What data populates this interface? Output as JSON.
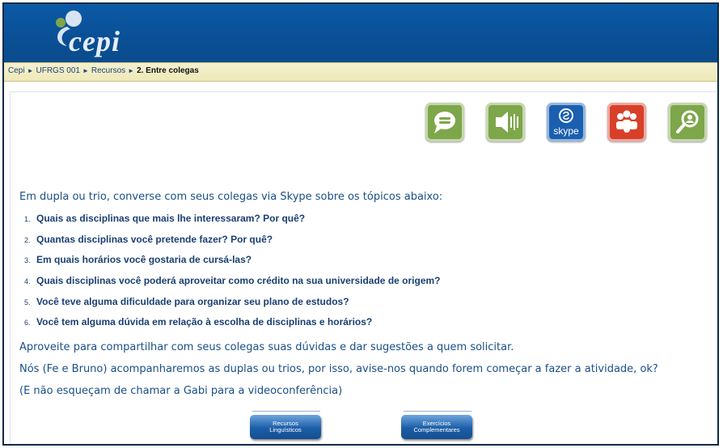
{
  "header": {
    "logo_text": "cepi"
  },
  "breadcrumb": {
    "items": [
      "Cepi",
      "UFRGS 001",
      "Recursos"
    ],
    "current": "2. Entre colegas",
    "separator": "►"
  },
  "toolbar_icons": [
    {
      "name": "chat-icon",
      "color": "#7ea64a"
    },
    {
      "name": "audio-icon",
      "color": "#7ea64a"
    },
    {
      "name": "skype-icon",
      "label": "skype",
      "color": "#1a5fb0"
    },
    {
      "name": "group-icon",
      "color": "#d8402a"
    },
    {
      "name": "search-person-icon",
      "color": "#7ea64a"
    }
  ],
  "main": {
    "intro": "Em dupla ou trio, converse com seus colegas via Skype sobre os tópicos abaixo:",
    "questions": [
      {
        "num": "1.",
        "text": "Quais as disciplinas que mais lhe interessaram? Por quê?"
      },
      {
        "num": "2.",
        "text": "Quantas disciplinas você pretende fazer? Por quê?"
      },
      {
        "num": "3.",
        "text": "Em quais horários você gostaria de cursá-las?"
      },
      {
        "num": "4.",
        "text": "Quais disciplinas você poderá aproveitar como crédito na sua universidade de origem?"
      },
      {
        "num": "5.",
        "text": "Você teve alguma dificuldade para organizar seu plano de estudos?"
      },
      {
        "num": "6.",
        "text": "Você tem alguma dúvida em relação à escolha de disciplinas e horários?"
      }
    ],
    "paragraph1": "Aproveite para compartilhar com seus colegas suas dúvidas e dar sugestões a quem solicitar.",
    "paragraph2": "Nós (Fe e Bruno) acompanharemos as duplas ou trios, por isso, avise-nos quando forem começar a fazer a atividade, ok?",
    "paragraph3": "(E não esqueçam de chamar a Gabi para a videoconferência)"
  },
  "buttons": {
    "recursos": {
      "line1": "Recursos",
      "line2": "Linguísticos"
    },
    "exercicios": {
      "line1": "Exercícios",
      "line2": "Complementares"
    }
  }
}
